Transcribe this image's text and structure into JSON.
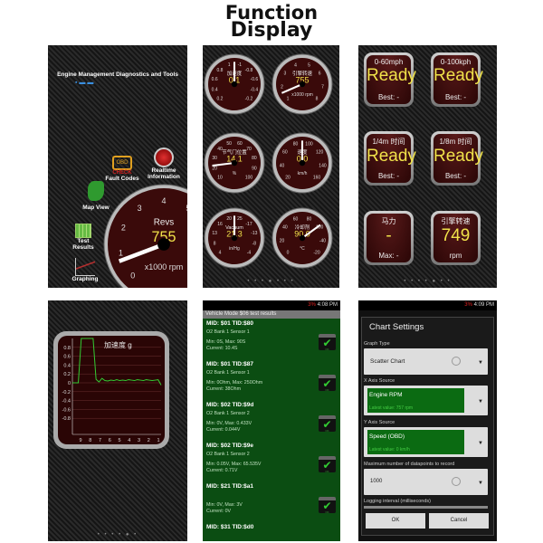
{
  "heading": {
    "line1": "Function",
    "line2": "Display"
  },
  "panel1": {
    "title": "Engine Management Diagnostics and Tools",
    "menu": [
      {
        "label": "Fault Codes",
        "icon": "check-engine-icon"
      },
      {
        "label": "Realtime Information",
        "icon": "speedometer-icon"
      },
      {
        "label": "Map View",
        "icon": "map-icon"
      },
      {
        "label": "Test Results",
        "icon": "table-icon"
      },
      {
        "label": "Graphing",
        "icon": "graph-icon"
      }
    ],
    "obd_badge": "OBD",
    "check_text": "CHECK",
    "gauge": {
      "label": "Revs",
      "value": "755",
      "unit1": "x1000",
      "unit2": "rpm",
      "ticks": [
        "0",
        "1",
        "2",
        "3",
        "4",
        "5",
        "6",
        "7",
        "8"
      ]
    }
  },
  "panel2": {
    "gauges": [
      {
        "label": "加速度",
        "value": "0.1",
        "unit": "",
        "ticks": [
          "0.2",
          "0.4",
          "0.6",
          "0.8",
          "1",
          "-1",
          "-0.8",
          "-0.6",
          "-0.4",
          "-0.2"
        ],
        "needle": 0.5
      },
      {
        "label": "引擎转速",
        "value": "755",
        "unit": "x1000 rpm",
        "ticks": [
          "1",
          "2",
          "3",
          "4",
          "5",
          "6",
          "7",
          "8"
        ],
        "needle": 0.08
      },
      {
        "label": "节气门位置",
        "value": "14.1",
        "unit": "%",
        "ticks": [
          "10",
          "20",
          "30",
          "40",
          "50",
          "60",
          "70",
          "80",
          "90",
          "100"
        ],
        "needle": 0.14
      },
      {
        "label": "速度",
        "value": "0.0",
        "unit": "km/h",
        "ticks": [
          "20",
          "40",
          "60",
          "80",
          "100",
          "120",
          "140",
          "160"
        ],
        "needle": 0.5
      },
      {
        "label": "Vacuum",
        "value": "21.3",
        "unit": "in/Hg",
        "ticks": [
          "4",
          "8",
          "13",
          "16",
          "20",
          "25",
          "-17",
          "-13",
          "-8",
          "-4"
        ],
        "needle": 0.5
      },
      {
        "label": "冷却剂",
        "value": "90.0",
        "unit": "°C",
        "ticks": [
          "0",
          "20",
          "40",
          "60",
          "80",
          "100",
          "-40",
          "-20"
        ],
        "needle": 0.7
      }
    ]
  },
  "panel3": {
    "tiles": [
      {
        "label": "0-60mph",
        "value": "Ready",
        "sub": "Best: -"
      },
      {
        "label": "0-100kph",
        "value": "Ready",
        "sub": "Best: -"
      },
      {
        "label": "1/4m 时间",
        "value": "Ready",
        "sub": "Best: -"
      },
      {
        "label": "1/8m 时间",
        "value": "Ready",
        "sub": "Best: -"
      },
      {
        "label": "马力",
        "value": "-",
        "sub": "Max: -"
      },
      {
        "label": "引擎转速",
        "value": "749",
        "sub": "rpm"
      }
    ]
  },
  "panel4": {
    "chart_data": {
      "type": "line",
      "title": "加速度 g",
      "yticks": [
        "0.8",
        "0.6",
        "0.4",
        "0.2",
        "0",
        "-0.2",
        "-0.4",
        "-0.6",
        "-0.8"
      ],
      "xticks": [
        "9",
        "8",
        "7",
        "6",
        "5",
        "4",
        "3",
        "2",
        "1"
      ],
      "ylim": [
        -1,
        1
      ],
      "values": [
        0,
        0,
        0,
        1,
        1,
        1,
        1,
        1,
        0.08,
        0.02,
        0.1,
        0.05,
        0.04,
        0.06,
        0.05,
        0.07,
        0.05,
        0.06,
        0.05,
        0.07,
        0.06,
        0.05,
        0.07,
        0.06,
        0.05,
        0.07,
        0.06,
        0.05,
        0.06,
        0.07,
        -0.05
      ]
    }
  },
  "panel5": {
    "status": {
      "battery": "3%",
      "time": "4:08 PM"
    },
    "header": "Vehicle Mode $06 test results",
    "items": [
      {
        "id": "MID: $01 TID:$80",
        "sensor": "O2 Bank 1 Sensor 1",
        "range": "Min: 0S, Max: 90S",
        "current": "Current: 10.4S"
      },
      {
        "id": "MID: $01 TID:$87",
        "sensor": "O2 Bank 1 Sensor 1",
        "range": "Min: 0Ohm, Max: 250Ohm",
        "current": "Current: 38Ohm"
      },
      {
        "id": "MID: $02 TID:$9d",
        "sensor": "O2 Bank 1 Sensor 2",
        "range": "Min: 0V, Max: 0.433V",
        "current": "Current: 0.044V"
      },
      {
        "id": "MID: $02 TID:$9e",
        "sensor": "O2 Bank 1 Sensor 2",
        "range": "Min: 0.05V, Max: 65.535V",
        "current": "Current: 0.71V"
      },
      {
        "id": "MID: $21 TID:$a1",
        "sensor": "",
        "range": "Min: 0V, Max: 3V",
        "current": "Current: 0V"
      },
      {
        "id": "MID: $31 TID:$d0",
        "sensor": "",
        "range": "",
        "current": ""
      }
    ],
    "ok_label": "OK"
  },
  "panel6": {
    "status": {
      "battery": "3%",
      "time": "4:09 PM"
    },
    "title": "Chart Settings",
    "graph_type_label": "Graph Type",
    "graph_type": "Scatter Chart",
    "x_label": "X Axis Source",
    "x_value": "Engine RPM",
    "x_latest": "Latest value: 757 rpm",
    "y_label": "Y Axis Source",
    "y_value": "Speed (OBD)",
    "y_latest": "Latest value: 0 km/h",
    "max_label": "Maximum number of datapoints to record",
    "max_value": "1000",
    "interval_label": "Logging interval (milliseconds)",
    "ok": "OK",
    "cancel": "Cancel"
  },
  "colors": {
    "gauge_face": "#3a0a0a",
    "value": "#f0e24a",
    "green_bg": "#0b4d12",
    "check": "#33cc33"
  }
}
